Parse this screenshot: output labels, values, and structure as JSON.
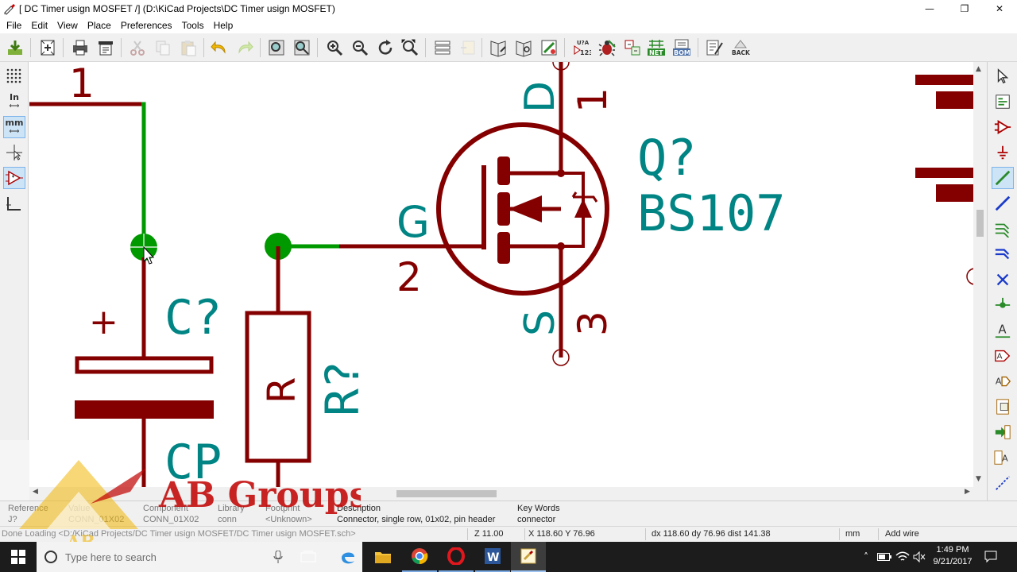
{
  "window": {
    "title": "[ DC Timer usign MOSFET /] (D:\\KiCad Projects\\DC Timer usign MOSFET)",
    "minimize": "—",
    "maximize": "❐",
    "close": "✕"
  },
  "menu": [
    "File",
    "Edit",
    "View",
    "Place",
    "Preferences",
    "Tools",
    "Help"
  ],
  "toolbar": {
    "annotate_text": "U?A 123",
    "net_text": "NET",
    "bom_text": "BOM",
    "back_text": "BACK"
  },
  "left_toolbar": {
    "units_in": "In",
    "units_mm": "mm"
  },
  "schematic": {
    "connector_pin": "1",
    "capacitor": {
      "ref": "C?",
      "value": "CP",
      "polarity": "+"
    },
    "resistor": {
      "ref": "R?",
      "body": "R"
    },
    "mosfet": {
      "ref": "Q?",
      "value": "BS107",
      "gate_label": "G",
      "gate_pin": "2",
      "drain_label": "D",
      "drain_pin": "1",
      "source_label": "S",
      "source_pin": "3"
    },
    "colors": {
      "wire": "#009900",
      "component": "#840000",
      "text": "#008484",
      "junction": "#009900"
    }
  },
  "info_panel": {
    "reference": {
      "label": "Reference",
      "value": "J?"
    },
    "value": {
      "label": "Value",
      "value": "CONN_01X02"
    },
    "component": {
      "label": "Component",
      "value": "CONN_01X02"
    },
    "library": {
      "label": "Library",
      "value": "conn"
    },
    "footprint": {
      "label": "Footprint",
      "value": "<Unknown>"
    },
    "description": {
      "label": "Description",
      "value": "Connector, single row, 01x02, pin header"
    },
    "keywords": {
      "label": "Key Words",
      "value": "connector"
    }
  },
  "status": {
    "message": "Done Loading <D:/KiCad Projects/DC Timer usign MOSFET/DC Timer usign MOSFET.sch>",
    "zoom": "Z 11.00",
    "xy": "X 118.60  Y 76.96",
    "delta": "dx 118.60  dy 76.96  dist 141.38",
    "units": "mm",
    "mode": "Add wire"
  },
  "taskbar": {
    "search_placeholder": "Type here to search",
    "time": "1:49 PM",
    "date": "9/21/2017"
  },
  "watermark": {
    "text": "AB Groups",
    "small": "AB"
  }
}
